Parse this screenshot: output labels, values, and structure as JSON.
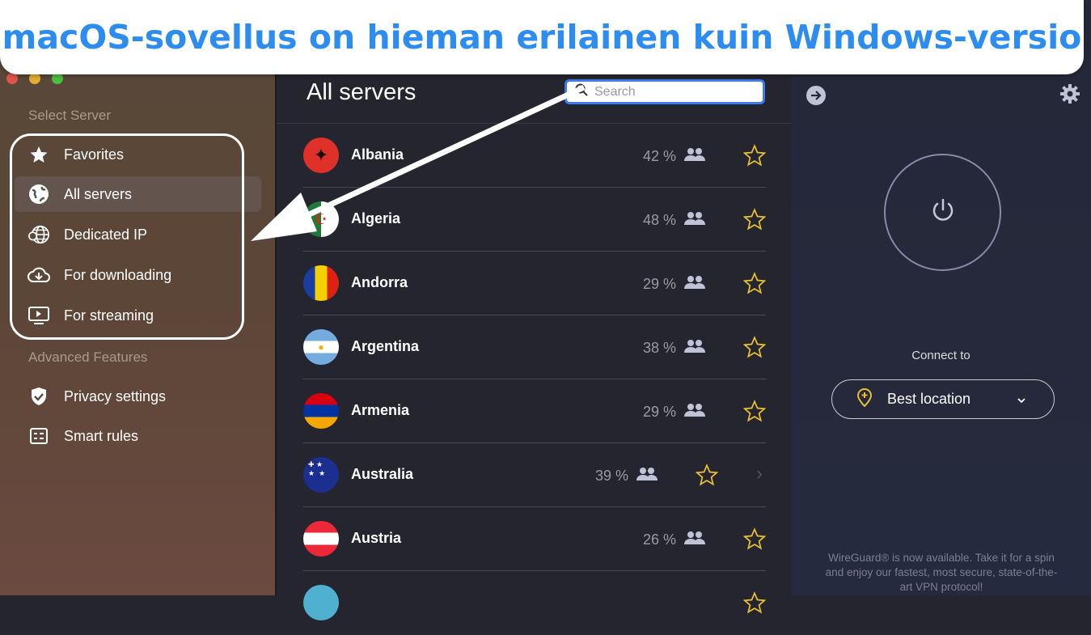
{
  "banner": {
    "text": "macOS-sovellus on hieman erilainen kuin Windows-versio"
  },
  "sidebar": {
    "section1": "Select Server",
    "items": [
      {
        "label": "Favorites",
        "icon": "star-icon"
      },
      {
        "label": "All servers",
        "icon": "globe-icon",
        "active": true
      },
      {
        "label": "Dedicated IP",
        "icon": "dedicated-ip-icon"
      },
      {
        "label": "For downloading",
        "icon": "cloud-download-icon"
      },
      {
        "label": "For streaming",
        "icon": "tv-play-icon"
      }
    ],
    "section2": "Advanced Features",
    "advanced": [
      {
        "label": "Privacy settings",
        "icon": "shield-check-icon"
      },
      {
        "label": "Smart rules",
        "icon": "rules-icon"
      }
    ]
  },
  "main": {
    "title": "All servers",
    "search_placeholder": "Search",
    "servers": [
      {
        "name": "Albania",
        "load": "42 %"
      },
      {
        "name": "Algeria",
        "load": "48 %"
      },
      {
        "name": "Andorra",
        "load": "29 %"
      },
      {
        "name": "Argentina",
        "load": "38 %"
      },
      {
        "name": "Armenia",
        "load": "29 %"
      },
      {
        "name": "Australia",
        "load": "39 %",
        "hovered": true
      },
      {
        "name": "Austria",
        "load": "26 %"
      },
      {
        "name": "",
        "load": ""
      }
    ]
  },
  "right": {
    "connect_label": "Connect to",
    "location": "Best location",
    "promo": "WireGuard® is now available. Take it for a spin and enjoy our fastest, most secure, state-of-the-art VPN protocol!"
  },
  "colors": {
    "accent": "#2d8cf0",
    "star": "#e8c030",
    "banner_bg": "#ffffff"
  }
}
